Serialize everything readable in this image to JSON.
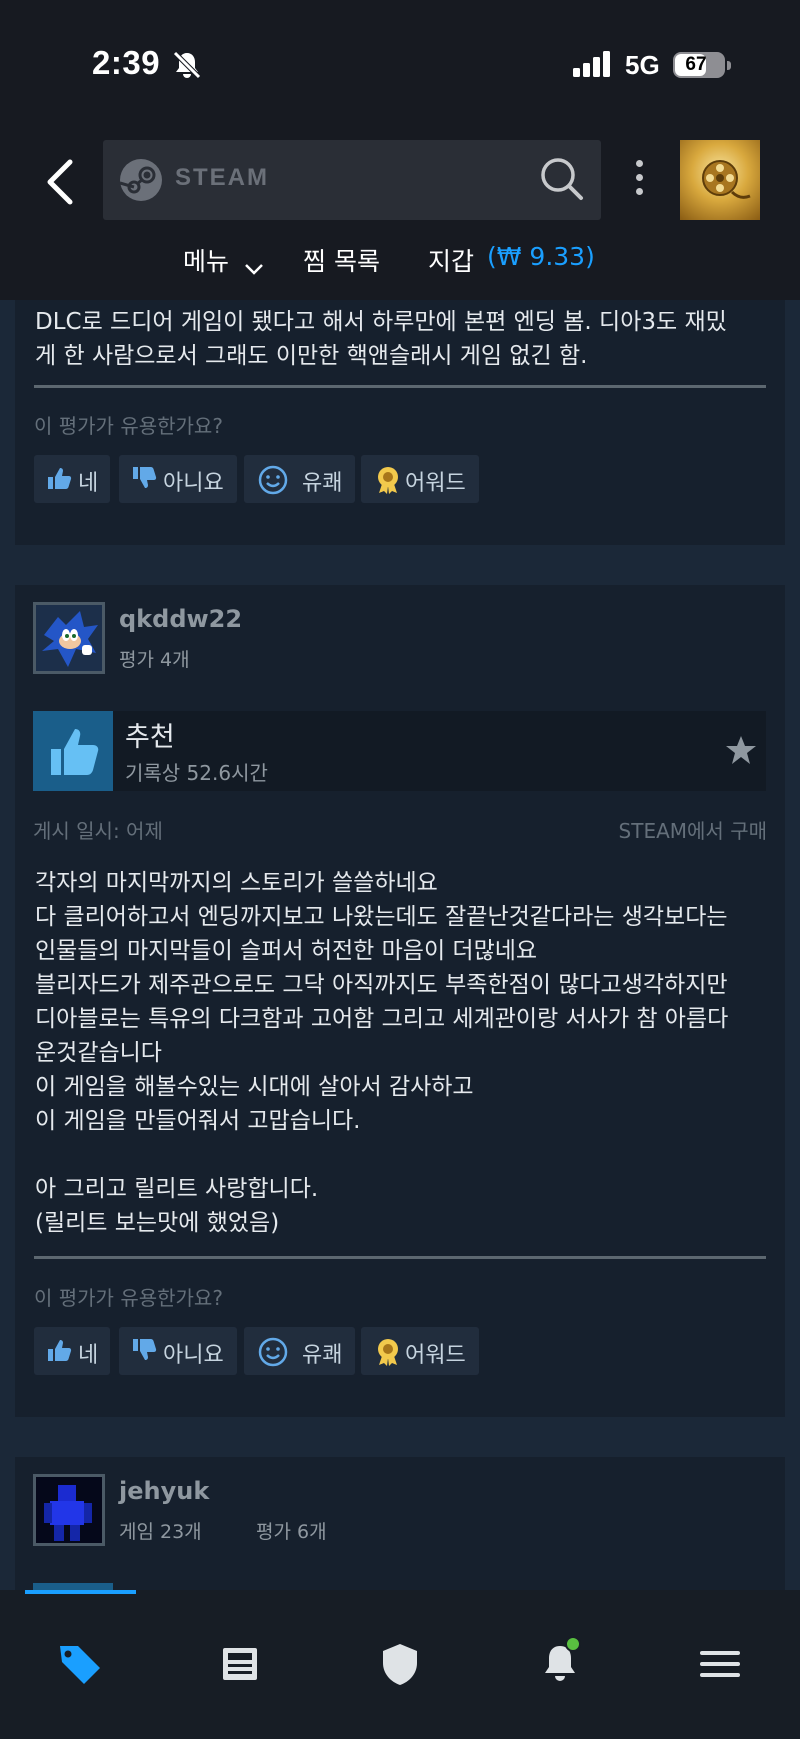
{
  "status_bar": {
    "time": "2:39",
    "network": "5G",
    "battery_level": 67,
    "battery_label": "67"
  },
  "header": {
    "search_brand": "STEAM",
    "nav_menu": "메뉴",
    "nav_wishlist": "찜 목록",
    "nav_wallet": "지갑",
    "wallet_amount": "(₩ 9.33)"
  },
  "reviews": [
    {
      "text_partial": "DLC로 드디어 게임이 됐다고 해서 하루만에 본편 엔딩 봄. 디아3도 재밌\n게 한 사람으로서 그래도 이만한 핵앤슬래시 게임 없긴 함.",
      "helpful_question": "이 평가가 유용한가요?",
      "buttons": {
        "yes": "네",
        "no": "아니요",
        "funny": "유쾌",
        "award": "어워드"
      }
    },
    {
      "author": "qkddw22",
      "author_meta": "평가 4개",
      "verdict": "추천",
      "hours": "기록상 52.6시간",
      "posted": "게시 일시: 어제",
      "purchase": "STEAM에서 구매",
      "text": "각자의 마지막까지의 스토리가 쓸쓸하네요\n다 클리어하고서 엔딩까지보고 나왔는데도 잘끝난것같다라는 생각보다는\n인물들의 마지막들이 슬퍼서 허전한 마음이 더많네요\n블리자드가 제주관으로도 그닥 아직까지도 부족한점이 많다고생각하지만\n디아블로는 특유의 다크함과 고어함 그리고 세계관이랑 서사가 참 아름다\n운것같습니다\n이 게임을 해볼수있는 시대에 살아서 감사하고\n이 게임을 만들어줘서 고맙습니다.\n\n아 그리고 릴리트 사랑합니다.\n(릴리트 보는맛에 했었음)",
      "helpful_question": "이 평가가 유용한가요?",
      "buttons": {
        "yes": "네",
        "no": "아니요",
        "funny": "유쾌",
        "award": "어워드"
      }
    },
    {
      "author": "jehyuk",
      "games": "게임 23개",
      "author_meta": "평가 6개"
    }
  ],
  "colors": {
    "background": "#1b2838",
    "card": "#16202d",
    "accent": "#1a9fff",
    "button": "#212d3d",
    "text": "#c6d4df"
  },
  "bottom_nav": {
    "active_index": 0,
    "items": [
      "store-tag-icon",
      "news-icon",
      "guard-shield-icon",
      "notification-bell-icon",
      "menu-icon"
    ]
  }
}
